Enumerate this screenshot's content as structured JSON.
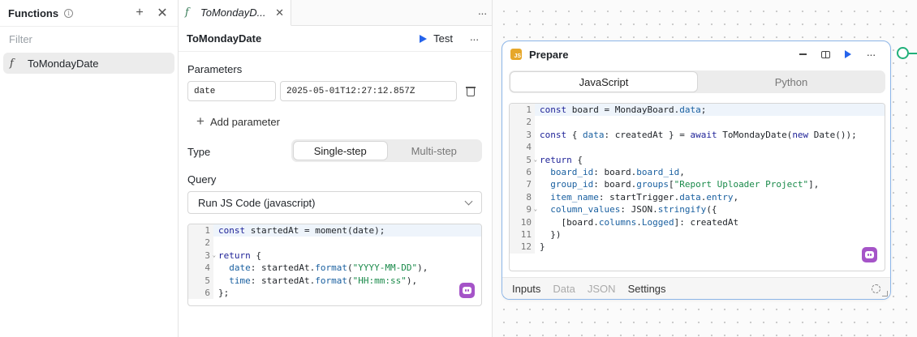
{
  "functions_panel": {
    "title": "Functions",
    "filter_placeholder": "Filter",
    "items": [
      {
        "label": "ToMondayDate",
        "selected": true
      }
    ]
  },
  "editor": {
    "tab_label": "ToMondayD...",
    "title": "ToMondayDate",
    "test_label": "Test",
    "parameters_label": "Parameters",
    "param_name": "date",
    "param_value": "2025-05-01T12:27:12.857Z",
    "add_parameter_label": "Add parameter",
    "type_label": "Type",
    "type_options": [
      "Single-step",
      "Multi-step"
    ],
    "type_selected": "Single-step",
    "query_label": "Query",
    "query_value": "Run JS Code (javascript)",
    "code_lines": [
      {
        "n": "1",
        "html": "<span class=\"kw\">const</span> startedAt = moment(date);"
      },
      {
        "n": "2",
        "html": ""
      },
      {
        "n": "3",
        "html": "<span class=\"kw\">return</span> {"
      },
      {
        "n": "4",
        "html": "  <span class=\"prop\">date</span>: startedAt.<span class=\"prop\">format</span>(<span class=\"str\">\"YYYY-MM-DD\"</span>),"
      },
      {
        "n": "5",
        "html": "  <span class=\"prop\">time</span>: startedAt.<span class=\"prop\">format</span>(<span class=\"str\">\"HH:mm:ss\"</span>),"
      },
      {
        "n": "6",
        "html": "};"
      }
    ]
  },
  "node": {
    "title": "Prepare",
    "badge": "JS",
    "lang_options": [
      "JavaScript",
      "Python"
    ],
    "lang_selected": "JavaScript",
    "code_lines": [
      {
        "n": "1",
        "html": "<span class=\"kw\">const</span> board = MondayBoard.<span class=\"prop\">data</span>;"
      },
      {
        "n": "2",
        "html": ""
      },
      {
        "n": "3",
        "html": "<span class=\"kw\">const</span> { <span class=\"prop\">data</span>: createdAt } = <span class=\"kw\">await</span> ToMondayDate(<span class=\"kw\">new</span> Date());"
      },
      {
        "n": "4",
        "html": ""
      },
      {
        "n": "5",
        "html": "<span class=\"kw\">return</span> {"
      },
      {
        "n": "6",
        "html": "  <span class=\"prop\">board_id</span>: board.<span class=\"prop\">board_id</span>,"
      },
      {
        "n": "7",
        "html": "  <span class=\"prop\">group_id</span>: board.<span class=\"prop\">groups</span>[<span class=\"str\">\"Report Uploader Project\"</span>],"
      },
      {
        "n": "8",
        "html": "  <span class=\"prop\">item_name</span>: startTrigger.<span class=\"prop\">data</span>.<span class=\"prop\">entry</span>,"
      },
      {
        "n": "9",
        "html": "  <span class=\"prop\">column_values</span>: JSON.<span class=\"prop\">stringify</span>({"
      },
      {
        "n": "10",
        "html": "    [board.<span class=\"prop\">columns</span>.<span class=\"prop\">Logged</span>]: createdAt"
      },
      {
        "n": "11",
        "html": "  })"
      },
      {
        "n": "12",
        "html": "}"
      }
    ],
    "bottom_tabs": [
      {
        "label": "Inputs",
        "active": true
      },
      {
        "label": "Data",
        "active": false
      },
      {
        "label": "JSON",
        "active": false
      },
      {
        "label": "Settings",
        "active": true
      }
    ]
  },
  "colors": {
    "accent": "#2563eb",
    "node_border": "#8db6e8",
    "connector": "#21b07a",
    "ai_badge": "#a554c8",
    "js_badge": "#e6a72a"
  }
}
